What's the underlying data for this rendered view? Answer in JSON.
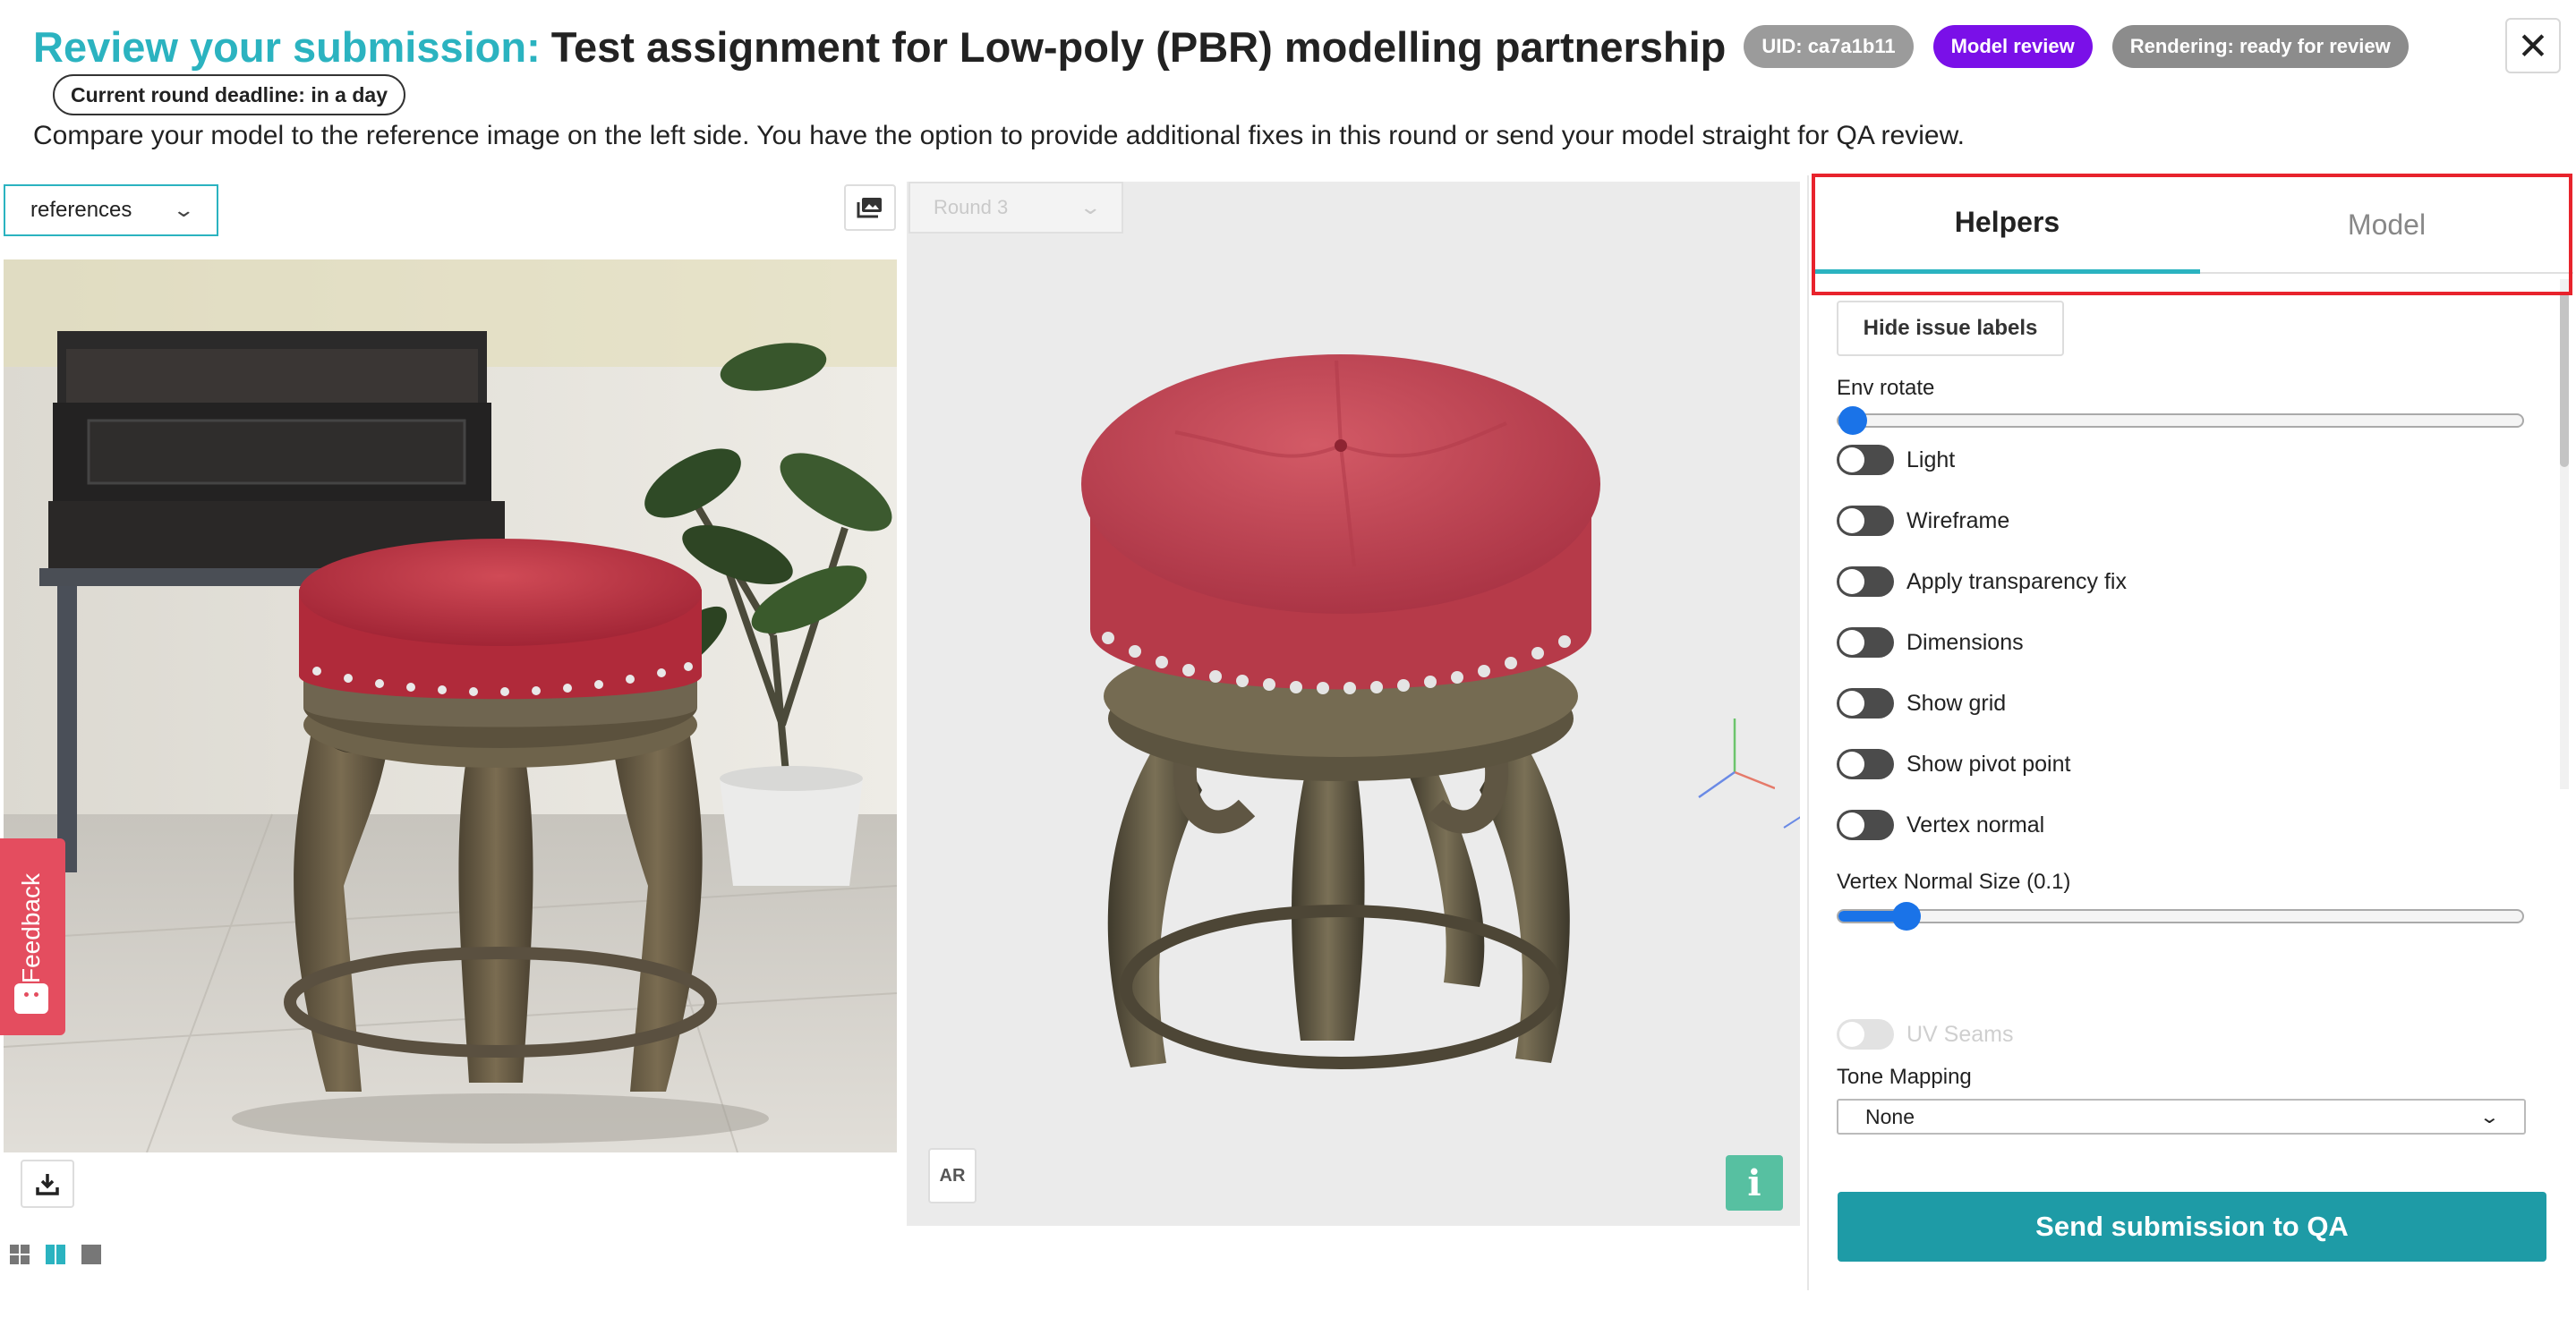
{
  "header": {
    "title_prefix": "Review your submission:",
    "title_main": "Test assignment for Low-poly (PBR) modelling partnership",
    "badges": [
      {
        "label": "UID: ca7a1b11",
        "color": "#9b9b9b"
      },
      {
        "label": "Model review",
        "color": "#7a10e8"
      },
      {
        "label": "Rendering: ready for review",
        "color": "#8c8c8c"
      }
    ],
    "deadline": "Current round deadline: in a day",
    "subtitle": "Compare your model to the reference image on the left side. You have the option to provide additional fixes in this round or send your model straight for QA review.",
    "close_icon": "close-icon"
  },
  "left_panel": {
    "select_value": "references",
    "gallery_icon": "gallery-icon",
    "download_icon": "download-icon"
  },
  "viewer": {
    "round_value": "Round 3",
    "ar_label": "AR",
    "info_label": "i"
  },
  "right_panel": {
    "tabs": [
      {
        "label": "Helpers",
        "active": true
      },
      {
        "label": "Model",
        "active": false
      }
    ],
    "hide_labels_button": "Hide issue labels",
    "env_rotate_label": "Env rotate",
    "env_rotate_value": 0,
    "toggles": [
      {
        "label": "Light",
        "on": false,
        "disabled": false
      },
      {
        "label": "Wireframe",
        "on": false,
        "disabled": false
      },
      {
        "label": "Apply transparency fix",
        "on": false,
        "disabled": false
      },
      {
        "label": "Dimensions",
        "on": false,
        "disabled": false
      },
      {
        "label": "Show grid",
        "on": false,
        "disabled": false
      },
      {
        "label": "Show pivot point",
        "on": false,
        "disabled": false
      },
      {
        "label": "Vertex normal",
        "on": false,
        "disabled": false
      }
    ],
    "vertex_normal_size_label": "Vertex Normal Size (0.1)",
    "vertex_normal_size_fraction": 0.1,
    "uv_seams_label": "UV Seams",
    "tone_mapping_label": "Tone Mapping",
    "tone_mapping_value": "None",
    "send_button": "Send submission to QA"
  },
  "feedback": {
    "label": "Feedback"
  },
  "colors": {
    "accent": "#2bb3c0",
    "primary_button": "#1e9ba6",
    "highlight": "#e8232c",
    "feedback": "#e44d5f"
  }
}
